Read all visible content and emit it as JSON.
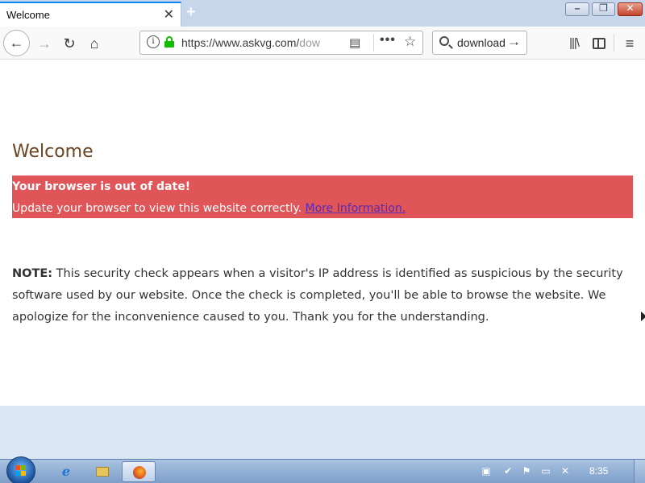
{
  "browser": {
    "tab": {
      "title": "Welcome",
      "close": "✕"
    },
    "newtab": "+",
    "window_controls": {
      "minimize": "–",
      "maximize": "❐",
      "close": "✕"
    },
    "nav": {
      "back": "←",
      "forward": "→",
      "reload": "↻",
      "home": "⌂",
      "url_prefix": "https://www.askvg.com/",
      "url_dim": "dow",
      "reader_icon": "▤",
      "more_icon": "•••",
      "star_icon": "☆",
      "search_text": "download",
      "search_go": "→",
      "library_icon": "|||\\",
      "menu_icon": "≡"
    }
  },
  "page": {
    "title": "Welcome",
    "alert": {
      "title": "Your browser is out of date!",
      "message": "Update your browser to view this website correctly.",
      "link": "More Information."
    },
    "note": {
      "label": "NOTE:",
      "text": "This security check appears when a visitor's IP address is identified as suspicious by the security software used by our website. Once the check is completed, you'll be able to browse the website. We apologize for the inconvenience caused to you. Thank you for the understanding."
    }
  },
  "taskbar": {
    "ie_icon": "e",
    "clock": "8:35",
    "tray": [
      "▣",
      "✔",
      "⚑",
      "▭",
      "✕"
    ]
  },
  "colors": {
    "alert_bg": "#e05558",
    "title_color": "#6b4420",
    "link_color": "#5a2ab5",
    "lock_green": "#12bc00"
  }
}
